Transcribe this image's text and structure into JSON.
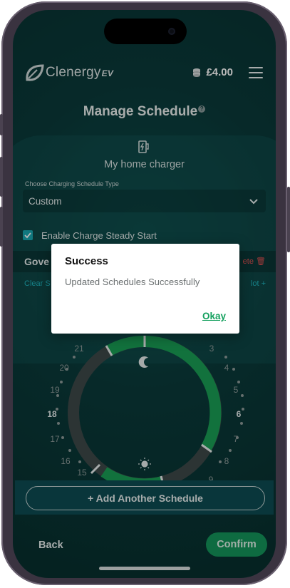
{
  "app": {
    "brand": "Clenergy",
    "brand_suffix": "EV"
  },
  "header": {
    "balance": "£4.00"
  },
  "page": {
    "title": "Manage Schedule"
  },
  "charger": {
    "name": "My home charger"
  },
  "schedule_type": {
    "label": "Choose Charging Schedule Type",
    "value": "Custom"
  },
  "steady_start": {
    "label": "Enable Charge Steady Start",
    "checked": true
  },
  "schedule_row": {
    "name": "Gove",
    "delete_label": "ete"
  },
  "slot_row": {
    "clear_label": "Clear S",
    "add_slot_label": "lot +"
  },
  "dial": {
    "hours": [
      "15",
      "16",
      "17",
      "18",
      "19",
      "20",
      "21",
      "3",
      "4",
      "5",
      "6",
      "7",
      "8",
      "9"
    ],
    "bold_hours": [
      "18",
      "6"
    ],
    "active_color": "#1a9f55",
    "inactive_color": "#3d4949"
  },
  "footer": {
    "add_schedule": "+ Add Another Schedule",
    "back": "Back",
    "confirm": "Confirm"
  },
  "dialog": {
    "title": "Success",
    "message": "Updated Schedules Successfully",
    "ok": "Okay"
  }
}
